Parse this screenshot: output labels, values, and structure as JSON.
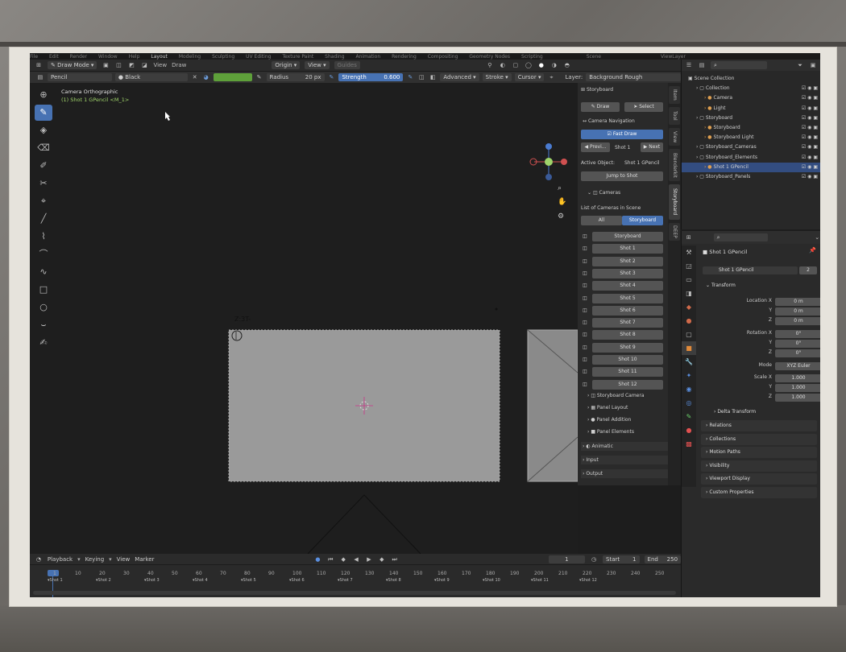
{
  "topmenu": [
    "File",
    "Edit",
    "Render",
    "Window",
    "Help",
    "Layout",
    "Modeling",
    "Sculpting",
    "UV Editing",
    "Texture Paint",
    "Shading",
    "Animation",
    "Rendering",
    "Compositing",
    "Geometry Nodes",
    "Scripting",
    "Scene",
    "ViewLayer"
  ],
  "header": {
    "mode": "Draw Mode",
    "view": "View",
    "draw": "Draw",
    "origin": "Origin",
    "view2": "View",
    "guides": "Guides"
  },
  "toolbar": {
    "brush": "Pencil",
    "material": "Black",
    "radius_label": "Radius",
    "radius_value": "20 px",
    "strength_label": "Strength",
    "strength_value": "0.600",
    "advanced": "Advanced",
    "stroke": "Stroke",
    "cursor": "Cursor",
    "layer_label": "Layer:",
    "layer_value": "Background Rough"
  },
  "viewport": {
    "camera_title": "Camera Orthographic",
    "object_label": "(1) Shot 1 GPencil <M_1>",
    "sketch_note": "Z:3T-",
    "panel_number": "(1)"
  },
  "npanel": {
    "title": "Storyboard",
    "draw": "Draw",
    "select": "Select",
    "camera_nav": "Camera Navigation",
    "fast_draw": "Fast Draw",
    "prev": "Previ...",
    "shot": "Shot 1",
    "next": "Next",
    "active_label": "Active Object:",
    "active_value": "Shot 1 GPencil",
    "jump": "Jump to Shot",
    "cameras": "Cameras",
    "list_label": "List of Cameras in Scene",
    "all": "All",
    "storyboard_tab": "Storyboard",
    "shots": [
      "Storyboard",
      "Shot 1",
      "Shot 2",
      "Shot 3",
      "Shot 4",
      "Shot 5",
      "Shot 6",
      "Shot 7",
      "Shot 8",
      "Shot 9",
      "Shot 10",
      "Shot 11",
      "Shot 12"
    ],
    "subpanels": [
      "Storyboard Camera",
      "Panel Layout",
      "Panel Addition",
      "Panel Elements"
    ],
    "animatic": "Animatic",
    "input": "Input",
    "output": "Output"
  },
  "vtabs": [
    "Item",
    "Tool",
    "View",
    "Blenderkit",
    "Storyboard",
    "DEEP"
  ],
  "outliner": [
    {
      "label": "Scene Collection",
      "indent": 0
    },
    {
      "label": "Collection",
      "indent": 1
    },
    {
      "label": "Camera",
      "indent": 2
    },
    {
      "label": "Light",
      "indent": 2
    },
    {
      "label": "Storyboard",
      "indent": 1
    },
    {
      "label": "Storyboard",
      "indent": 2
    },
    {
      "label": "Storyboard Light",
      "indent": 2
    },
    {
      "label": "Storyboard_Cameras",
      "indent": 1
    },
    {
      "label": "Storyboard_Elements",
      "indent": 1
    },
    {
      "label": "Shot 1 GPencil",
      "indent": 2
    },
    {
      "label": "Storyboard_Panels",
      "indent": 1
    }
  ],
  "properties": {
    "object": "Shot 1 GPencil",
    "object2": "Shot 1 GPencil",
    "users": "2",
    "transform": "Transform",
    "loc_label": "Location X",
    "y": "Y",
    "z": "Z",
    "loc_x": "0 m",
    "loc_y": "0 m",
    "loc_z": "0 m",
    "rot_label": "Rotation X",
    "rot_x": "0°",
    "rot_y": "0°",
    "rot_z": "0°",
    "mode_label": "Mode",
    "mode_value": "XYZ Euler",
    "scale_label": "Scale X",
    "scale_x": "1.000",
    "scale_y": "1.000",
    "scale_z": "1.000",
    "delta": "Delta Transform",
    "sections": [
      "Relations",
      "Collections",
      "Motion Paths",
      "Visibility",
      "Viewport Display",
      "Custom Properties"
    ]
  },
  "timeline": {
    "playback": "Playback",
    "keying": "Keying",
    "view": "View",
    "marker": "Marker",
    "frame": "1",
    "start_label": "Start",
    "start": "1",
    "end_label": "End",
    "end": "250",
    "numbers": [
      "1",
      "10",
      "20",
      "30",
      "40",
      "50",
      "60",
      "70",
      "80",
      "90",
      "100",
      "110",
      "120",
      "130",
      "140",
      "150",
      "160",
      "170",
      "180",
      "190",
      "200",
      "210",
      "220",
      "230",
      "240",
      "250"
    ],
    "markers": [
      "Shot 1",
      "Shot 2",
      "Shot 3",
      "Shot 4",
      "Shot 5",
      "Shot 6",
      "Shot 7",
      "Shot 8",
      "Shot 9",
      "Shot 10",
      "Shot 11",
      "Shot 12"
    ]
  },
  "colors": {
    "accent": "#4772b3",
    "active_text": "#9fd36a",
    "camera_frame": "#9a9a9a"
  }
}
